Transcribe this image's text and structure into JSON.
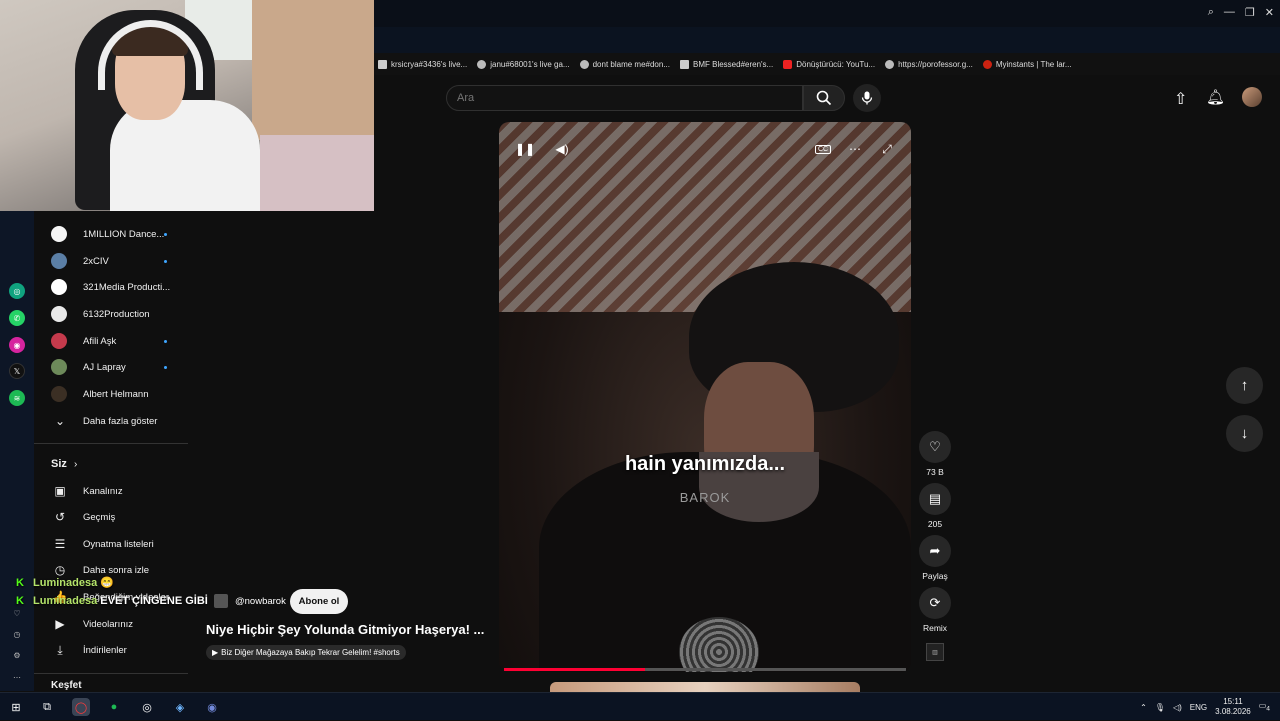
{
  "browser": {
    "bookmarks": [
      {
        "label": "krsicrya#3436's live..."
      },
      {
        "label": "janu#68001's live ga..."
      },
      {
        "label": "dont blame me#don..."
      },
      {
        "label": "BMF Blessed#eren's..."
      },
      {
        "label": "Dönüştürücü: YouTu..."
      },
      {
        "label": "https://porofessor.g..."
      },
      {
        "label": "Myinstants | The lar..."
      }
    ]
  },
  "search": {
    "placeholder": "Ara"
  },
  "sidebar": {
    "subscriptions": [
      {
        "name": "1MILLION Dance...",
        "live_dot": true,
        "color": "#f5f5f5"
      },
      {
        "name": "2xCIV",
        "live_dot": true,
        "color": "#5b7fa6"
      },
      {
        "name": "321Media Producti...",
        "live_dot": false,
        "color": "#ffffff"
      },
      {
        "name": "6132Production",
        "live_dot": false,
        "color": "#e8e8e8"
      },
      {
        "name": "Afili Aşk",
        "live_dot": true,
        "color": "#c53a4c"
      },
      {
        "name": "AJ Lapray",
        "live_dot": true,
        "color": "#6d8a5a"
      },
      {
        "name": "Albert Helmann",
        "live_dot": false,
        "color": "#3b2f24"
      }
    ],
    "show_more": "Daha fazla göster",
    "you_header": "Siz",
    "you_items": [
      {
        "label": "Kanalınız",
        "icon": "channel-icon"
      },
      {
        "label": "Geçmiş",
        "icon": "history-icon"
      },
      {
        "label": "Oynatma listeleri",
        "icon": "playlists-icon"
      },
      {
        "label": "Daha sonra izle",
        "icon": "watch-later-icon"
      },
      {
        "label": "Beğendiğim videolar",
        "icon": "liked-icon"
      },
      {
        "label": "Videolarınız",
        "icon": "your-videos-icon"
      },
      {
        "label": "İndirilenler",
        "icon": "downloads-icon"
      }
    ],
    "explore_header": "Keşfet"
  },
  "video": {
    "caption": "hain yanımızda...",
    "watermark": "BAROK",
    "progress": 0.35,
    "channel_handle": "@nowbarok",
    "subscribe_label": "Abone ol",
    "title": "Niye Hiçbir Şey Yolunda Gitmiyor Haşerya! ...",
    "sub_link": "Biz Diğer Mağazaya Bakıp Tekrar Gelelim! #shorts"
  },
  "actions": {
    "like_count": "73 B",
    "comment_count": "205",
    "share_label": "Paylaş",
    "remix_label": "Remix"
  },
  "chat": [
    {
      "user": "Luminadesa",
      "message": "😁"
    },
    {
      "user": "Luminadesa",
      "message": "EVET ÇİNGENE GİBİ"
    }
  ],
  "taskbar": {
    "lang": "ENG",
    "time": "15:11",
    "date": "3.08.2026",
    "notification_count": "4"
  },
  "colors": {
    "accent_red": "#ff0033",
    "kick_green": "#53fc18"
  }
}
